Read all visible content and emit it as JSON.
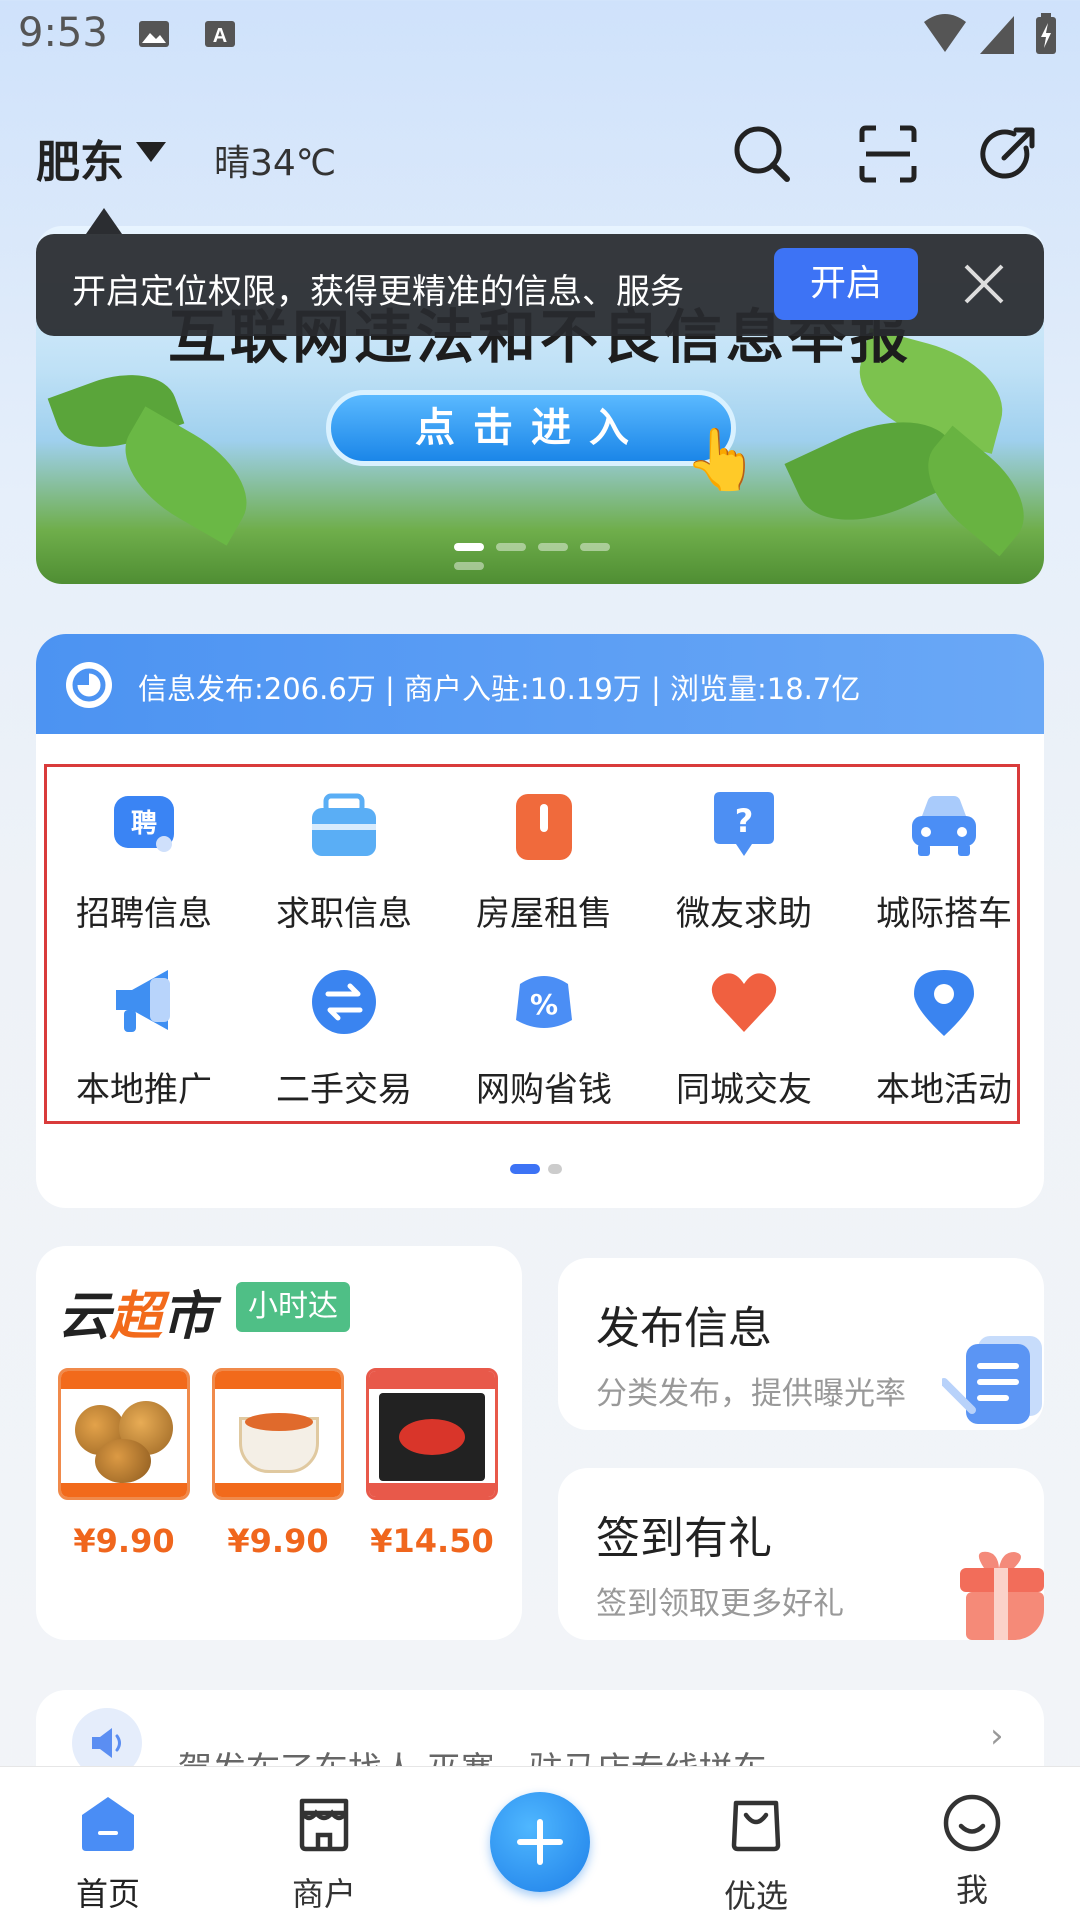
{
  "status_bar": {
    "time": "9:53",
    "icons": [
      "image-icon",
      "a-icon",
      "wifi-icon",
      "signal-icon",
      "battery-icon"
    ]
  },
  "header": {
    "city": "肥东",
    "weather": "晴34℃",
    "icons": [
      "search-icon",
      "scan-icon",
      "share-icon"
    ]
  },
  "banner": {
    "title": "互联网违法和不良信息举报",
    "button": "点击进入",
    "slides": 5,
    "active_slide": 1
  },
  "location_tip": {
    "text": "开启定位权限，获得更精准的信息、服务",
    "button": "开启"
  },
  "stats": {
    "text": "信息发布:206.6万 | 商户入驻:10.19万 | 浏览量:18.7亿"
  },
  "categories": [
    {
      "label": "招聘信息",
      "icon": "recruit-icon",
      "color": "#3a84f4"
    },
    {
      "label": "求职信息",
      "icon": "briefcase-icon",
      "color": "#5aaef5"
    },
    {
      "label": "房屋租售",
      "icon": "door-icon",
      "color": "#f06a3c"
    },
    {
      "label": "微友求助",
      "icon": "question-bubble-icon",
      "color": "#4d8ff3"
    },
    {
      "label": "城际搭车",
      "icon": "car-icon",
      "color": "#4b8ef5"
    },
    {
      "label": "本地推广",
      "icon": "megaphone-icon",
      "color": "#3f8ff2"
    },
    {
      "label": "二手交易",
      "icon": "exchange-icon",
      "color": "#3a84f0"
    },
    {
      "label": "网购省钱",
      "icon": "discount-icon",
      "color": "#4b8ef5"
    },
    {
      "label": "同城交友",
      "icon": "heart-icon",
      "color": "#f06040"
    },
    {
      "label": "本地活动",
      "icon": "location-pin-icon",
      "color": "#3a84f0"
    }
  ],
  "category_pages": {
    "total": 2,
    "active": 1
  },
  "market": {
    "title_a": "云",
    "title_b": "超",
    "title_c": "市",
    "tag": "小时达",
    "products": [
      {
        "price": "¥9.90",
        "image": "pumpkin-product"
      },
      {
        "price": "¥9.90",
        "image": "noodle-cup-product"
      },
      {
        "price": "¥14.50",
        "image": "noodle-pack-product"
      }
    ]
  },
  "publish": {
    "title": "发布信息",
    "subtitle": "分类发布，提供曝光率"
  },
  "signin": {
    "title": "签到有礼",
    "subtitle": "签到领取更多好礼"
  },
  "notice": {
    "text": "賀发布了车找人    巫寨一驻马店专线拼车"
  },
  "tabbar": {
    "items": [
      {
        "label": "首页",
        "icon": "home-icon"
      },
      {
        "label": "商户",
        "icon": "store-icon"
      },
      {
        "label": "",
        "icon": "plus-icon"
      },
      {
        "label": "优选",
        "icon": "shopping-bag-icon"
      },
      {
        "label": "我",
        "icon": "smile-icon"
      }
    ],
    "active": "首页"
  }
}
